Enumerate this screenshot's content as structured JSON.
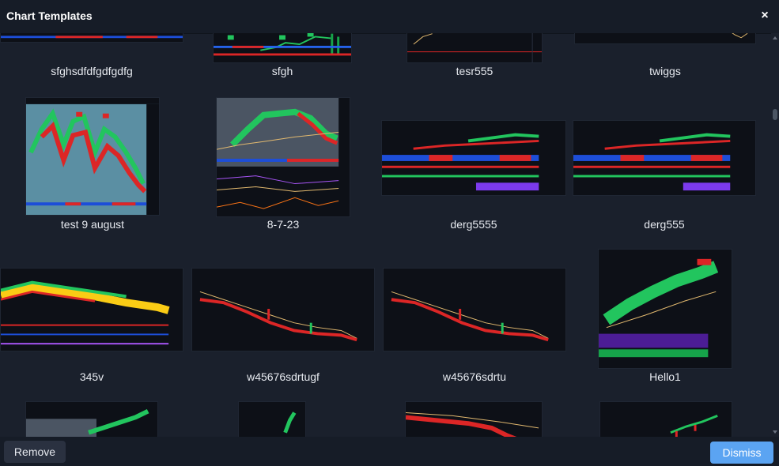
{
  "dialog": {
    "title": "Chart Templates",
    "close_label": "×"
  },
  "templates": {
    "row1": [
      "sfghsdfdfgdfgdfg",
      "sfgh",
      "tesr555",
      "twiggs"
    ],
    "row2": [
      "test 9 august",
      "8-7-23",
      "derg5555",
      "derg555"
    ],
    "row3": [
      "345v",
      "w45676sdrtugf",
      "w45676sdrtu",
      "Hello1"
    ]
  },
  "footer": {
    "remove_label": "Remove",
    "dismiss_label": "Dismiss"
  },
  "colors": {
    "accent": "#5ba4f2",
    "bull": "#22c55e",
    "bear": "#ef4444",
    "panel": "#0d1017"
  }
}
